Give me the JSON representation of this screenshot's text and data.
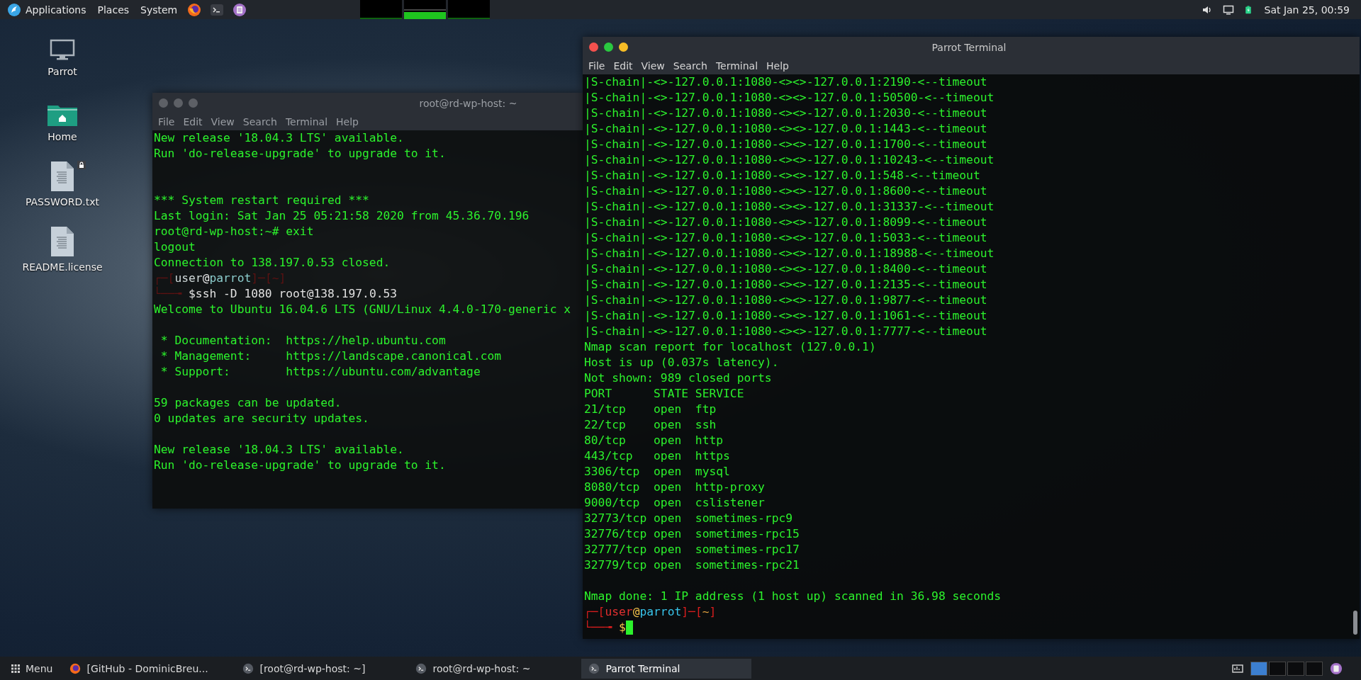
{
  "top_panel": {
    "menus": [
      {
        "label": "Applications",
        "kind": "logo"
      },
      {
        "label": "Places",
        "kind": "plain"
      },
      {
        "label": "System",
        "kind": "plain"
      }
    ],
    "launchers": [
      {
        "kind": "browser"
      },
      {
        "kind": "terminal"
      },
      {
        "kind": "notes"
      }
    ],
    "tray": [
      {
        "kind": "volume"
      },
      {
        "kind": "screen"
      },
      {
        "kind": "battery"
      }
    ],
    "clock": "Sat Jan 25, 00:59"
  },
  "desktop_icons": [
    {
      "label": "Parrot",
      "kind": "computer",
      "locked": false
    },
    {
      "label": "Home",
      "kind": "folder",
      "locked": false
    },
    {
      "label": "PASSWORD.txt",
      "kind": "file",
      "locked": true
    },
    {
      "label": "README.license",
      "kind": "file",
      "locked": false
    }
  ],
  "windows": [
    {
      "title": "root@rd-wp-host: ~",
      "active": false,
      "menu": [
        "File",
        "Edit",
        "View",
        "Search",
        "Terminal",
        "Help"
      ],
      "lines": [
        {
          "kind": "text",
          "text": "New release '18.04.3 LTS' available."
        },
        {
          "kind": "text",
          "text": "Run 'do-release-upgrade' to upgrade to it."
        },
        {
          "kind": "blank"
        },
        {
          "kind": "blank"
        },
        {
          "kind": "text",
          "text": "*** System restart required ***"
        },
        {
          "kind": "text",
          "text": "Last login: Sat Jan 25 05:21:58 2020 from 45.36.70.196"
        },
        {
          "kind": "text",
          "text": "root@rd-wp-host:~# exit"
        },
        {
          "kind": "text",
          "text": "logout"
        },
        {
          "kind": "text",
          "text": "Connection to 138.197.0.53 closed."
        },
        {
          "kind": "prompt",
          "cursor": false,
          "segments": [
            {
              "color": "#5c1212",
              "text": "┌─["
            },
            {
              "color": "#cfd8d8",
              "text": "user"
            },
            {
              "color": "#e8e8e8",
              "text": "@"
            },
            {
              "color": "#8ccccc",
              "text": "parrot"
            },
            {
              "color": "#5c1212",
              "text": "]─["
            },
            {
              "color": "#5c1212",
              "text": "~"
            },
            {
              "color": "#5c1212",
              "text": "]"
            }
          ]
        },
        {
          "kind": "prompt",
          "cursor": false,
          "segments": [
            {
              "color": "#5c1212",
              "text": "└──╼ "
            },
            {
              "color": "#e0e0e0",
              "text": "$"
            },
            {
              "color": "#e0e0e0",
              "text": "ssh -D 1080 root@138.197.0.53"
            }
          ]
        },
        {
          "kind": "text",
          "text": "Welcome to Ubuntu 16.04.6 LTS (GNU/Linux 4.4.0-170-generic x"
        },
        {
          "kind": "blank"
        },
        {
          "kind": "text",
          "text": " * Documentation:  https://help.ubuntu.com"
        },
        {
          "kind": "text",
          "text": " * Management:     https://landscape.canonical.com"
        },
        {
          "kind": "text",
          "text": " * Support:        https://ubuntu.com/advantage"
        },
        {
          "kind": "blank"
        },
        {
          "kind": "text",
          "text": "59 packages can be updated."
        },
        {
          "kind": "text",
          "text": "0 updates are security updates."
        },
        {
          "kind": "blank"
        },
        {
          "kind": "text",
          "text": "New release '18.04.3 LTS' available."
        },
        {
          "kind": "text",
          "text": "Run 'do-release-upgrade' to upgrade to it."
        }
      ]
    },
    {
      "title": "Parrot Terminal",
      "active": true,
      "menu": [
        "File",
        "Edit",
        "View",
        "Search",
        "Terminal",
        "Help"
      ],
      "lines": [
        {
          "kind": "text",
          "text": "|S-chain|-<>-127.0.0.1:1080-<><>-127.0.0.1:2190-<--timeout"
        },
        {
          "kind": "text",
          "text": "|S-chain|-<>-127.0.0.1:1080-<><>-127.0.0.1:50500-<--timeout"
        },
        {
          "kind": "text",
          "text": "|S-chain|-<>-127.0.0.1:1080-<><>-127.0.0.1:2030-<--timeout"
        },
        {
          "kind": "text",
          "text": "|S-chain|-<>-127.0.0.1:1080-<><>-127.0.0.1:1443-<--timeout"
        },
        {
          "kind": "text",
          "text": "|S-chain|-<>-127.0.0.1:1080-<><>-127.0.0.1:1700-<--timeout"
        },
        {
          "kind": "text",
          "text": "|S-chain|-<>-127.0.0.1:1080-<><>-127.0.0.1:10243-<--timeout"
        },
        {
          "kind": "text",
          "text": "|S-chain|-<>-127.0.0.1:1080-<><>-127.0.0.1:548-<--timeout"
        },
        {
          "kind": "text",
          "text": "|S-chain|-<>-127.0.0.1:1080-<><>-127.0.0.1:8600-<--timeout"
        },
        {
          "kind": "text",
          "text": "|S-chain|-<>-127.0.0.1:1080-<><>-127.0.0.1:31337-<--timeout"
        },
        {
          "kind": "text",
          "text": "|S-chain|-<>-127.0.0.1:1080-<><>-127.0.0.1:8099-<--timeout"
        },
        {
          "kind": "text",
          "text": "|S-chain|-<>-127.0.0.1:1080-<><>-127.0.0.1:5033-<--timeout"
        },
        {
          "kind": "text",
          "text": "|S-chain|-<>-127.0.0.1:1080-<><>-127.0.0.1:18988-<--timeout"
        },
        {
          "kind": "text",
          "text": "|S-chain|-<>-127.0.0.1:1080-<><>-127.0.0.1:8400-<--timeout"
        },
        {
          "kind": "text",
          "text": "|S-chain|-<>-127.0.0.1:1080-<><>-127.0.0.1:2135-<--timeout"
        },
        {
          "kind": "text",
          "text": "|S-chain|-<>-127.0.0.1:1080-<><>-127.0.0.1:9877-<--timeout"
        },
        {
          "kind": "text",
          "text": "|S-chain|-<>-127.0.0.1:1080-<><>-127.0.0.1:1061-<--timeout"
        },
        {
          "kind": "text",
          "text": "|S-chain|-<>-127.0.0.1:1080-<><>-127.0.0.1:7777-<--timeout"
        },
        {
          "kind": "text",
          "text": "Nmap scan report for localhost (127.0.0.1)"
        },
        {
          "kind": "text",
          "text": "Host is up (0.037s latency)."
        },
        {
          "kind": "text",
          "text": "Not shown: 989 closed ports"
        },
        {
          "kind": "text",
          "text": "PORT      STATE SERVICE"
        },
        {
          "kind": "text",
          "text": "21/tcp    open  ftp"
        },
        {
          "kind": "text",
          "text": "22/tcp    open  ssh"
        },
        {
          "kind": "text",
          "text": "80/tcp    open  http"
        },
        {
          "kind": "text",
          "text": "443/tcp   open  https"
        },
        {
          "kind": "text",
          "text": "3306/tcp  open  mysql"
        },
        {
          "kind": "text",
          "text": "8080/tcp  open  http-proxy"
        },
        {
          "kind": "text",
          "text": "9000/tcp  open  cslistener"
        },
        {
          "kind": "text",
          "text": "32773/tcp open  sometimes-rpc9"
        },
        {
          "kind": "text",
          "text": "32776/tcp open  sometimes-rpc15"
        },
        {
          "kind": "text",
          "text": "32777/tcp open  sometimes-rpc17"
        },
        {
          "kind": "text",
          "text": "32779/tcp open  sometimes-rpc21"
        },
        {
          "kind": "blank"
        },
        {
          "kind": "text",
          "text": "Nmap done: 1 IP address (1 host up) scanned in 36.98 seconds"
        },
        {
          "kind": "prompt",
          "cursor": false,
          "segments": [
            {
              "color": "#d81e1e",
              "text": "┌─["
            },
            {
              "color": "#e23030",
              "text": "user"
            },
            {
              "color": "#f2c14a",
              "text": "@"
            },
            {
              "color": "#38c4ea",
              "text": "parrot"
            },
            {
              "color": "#d81e1e",
              "text": "]─["
            },
            {
              "color": "#e0a040",
              "text": "~"
            },
            {
              "color": "#d81e1e",
              "text": "]"
            }
          ]
        },
        {
          "kind": "prompt",
          "cursor": true,
          "segments": [
            {
              "color": "#d81e1e",
              "text": "└──╼ "
            },
            {
              "color": "#f2c14a",
              "text": "$"
            }
          ]
        }
      ]
    }
  ],
  "taskbar": {
    "menu": "Menu",
    "tasks": [
      {
        "label": "[GitHub - DominicBreu...",
        "kind": "browser",
        "selected": false
      },
      {
        "label": "[root@rd-wp-host: ~]",
        "kind": "terminal",
        "selected": false
      },
      {
        "label": "root@rd-wp-host: ~",
        "kind": "terminal",
        "selected": false
      },
      {
        "label": "Parrot Terminal",
        "kind": "terminal",
        "selected": true
      }
    ],
    "workspaces": [
      {
        "selected": true
      },
      {
        "selected": false
      },
      {
        "selected": false
      },
      {
        "selected": false
      }
    ]
  }
}
